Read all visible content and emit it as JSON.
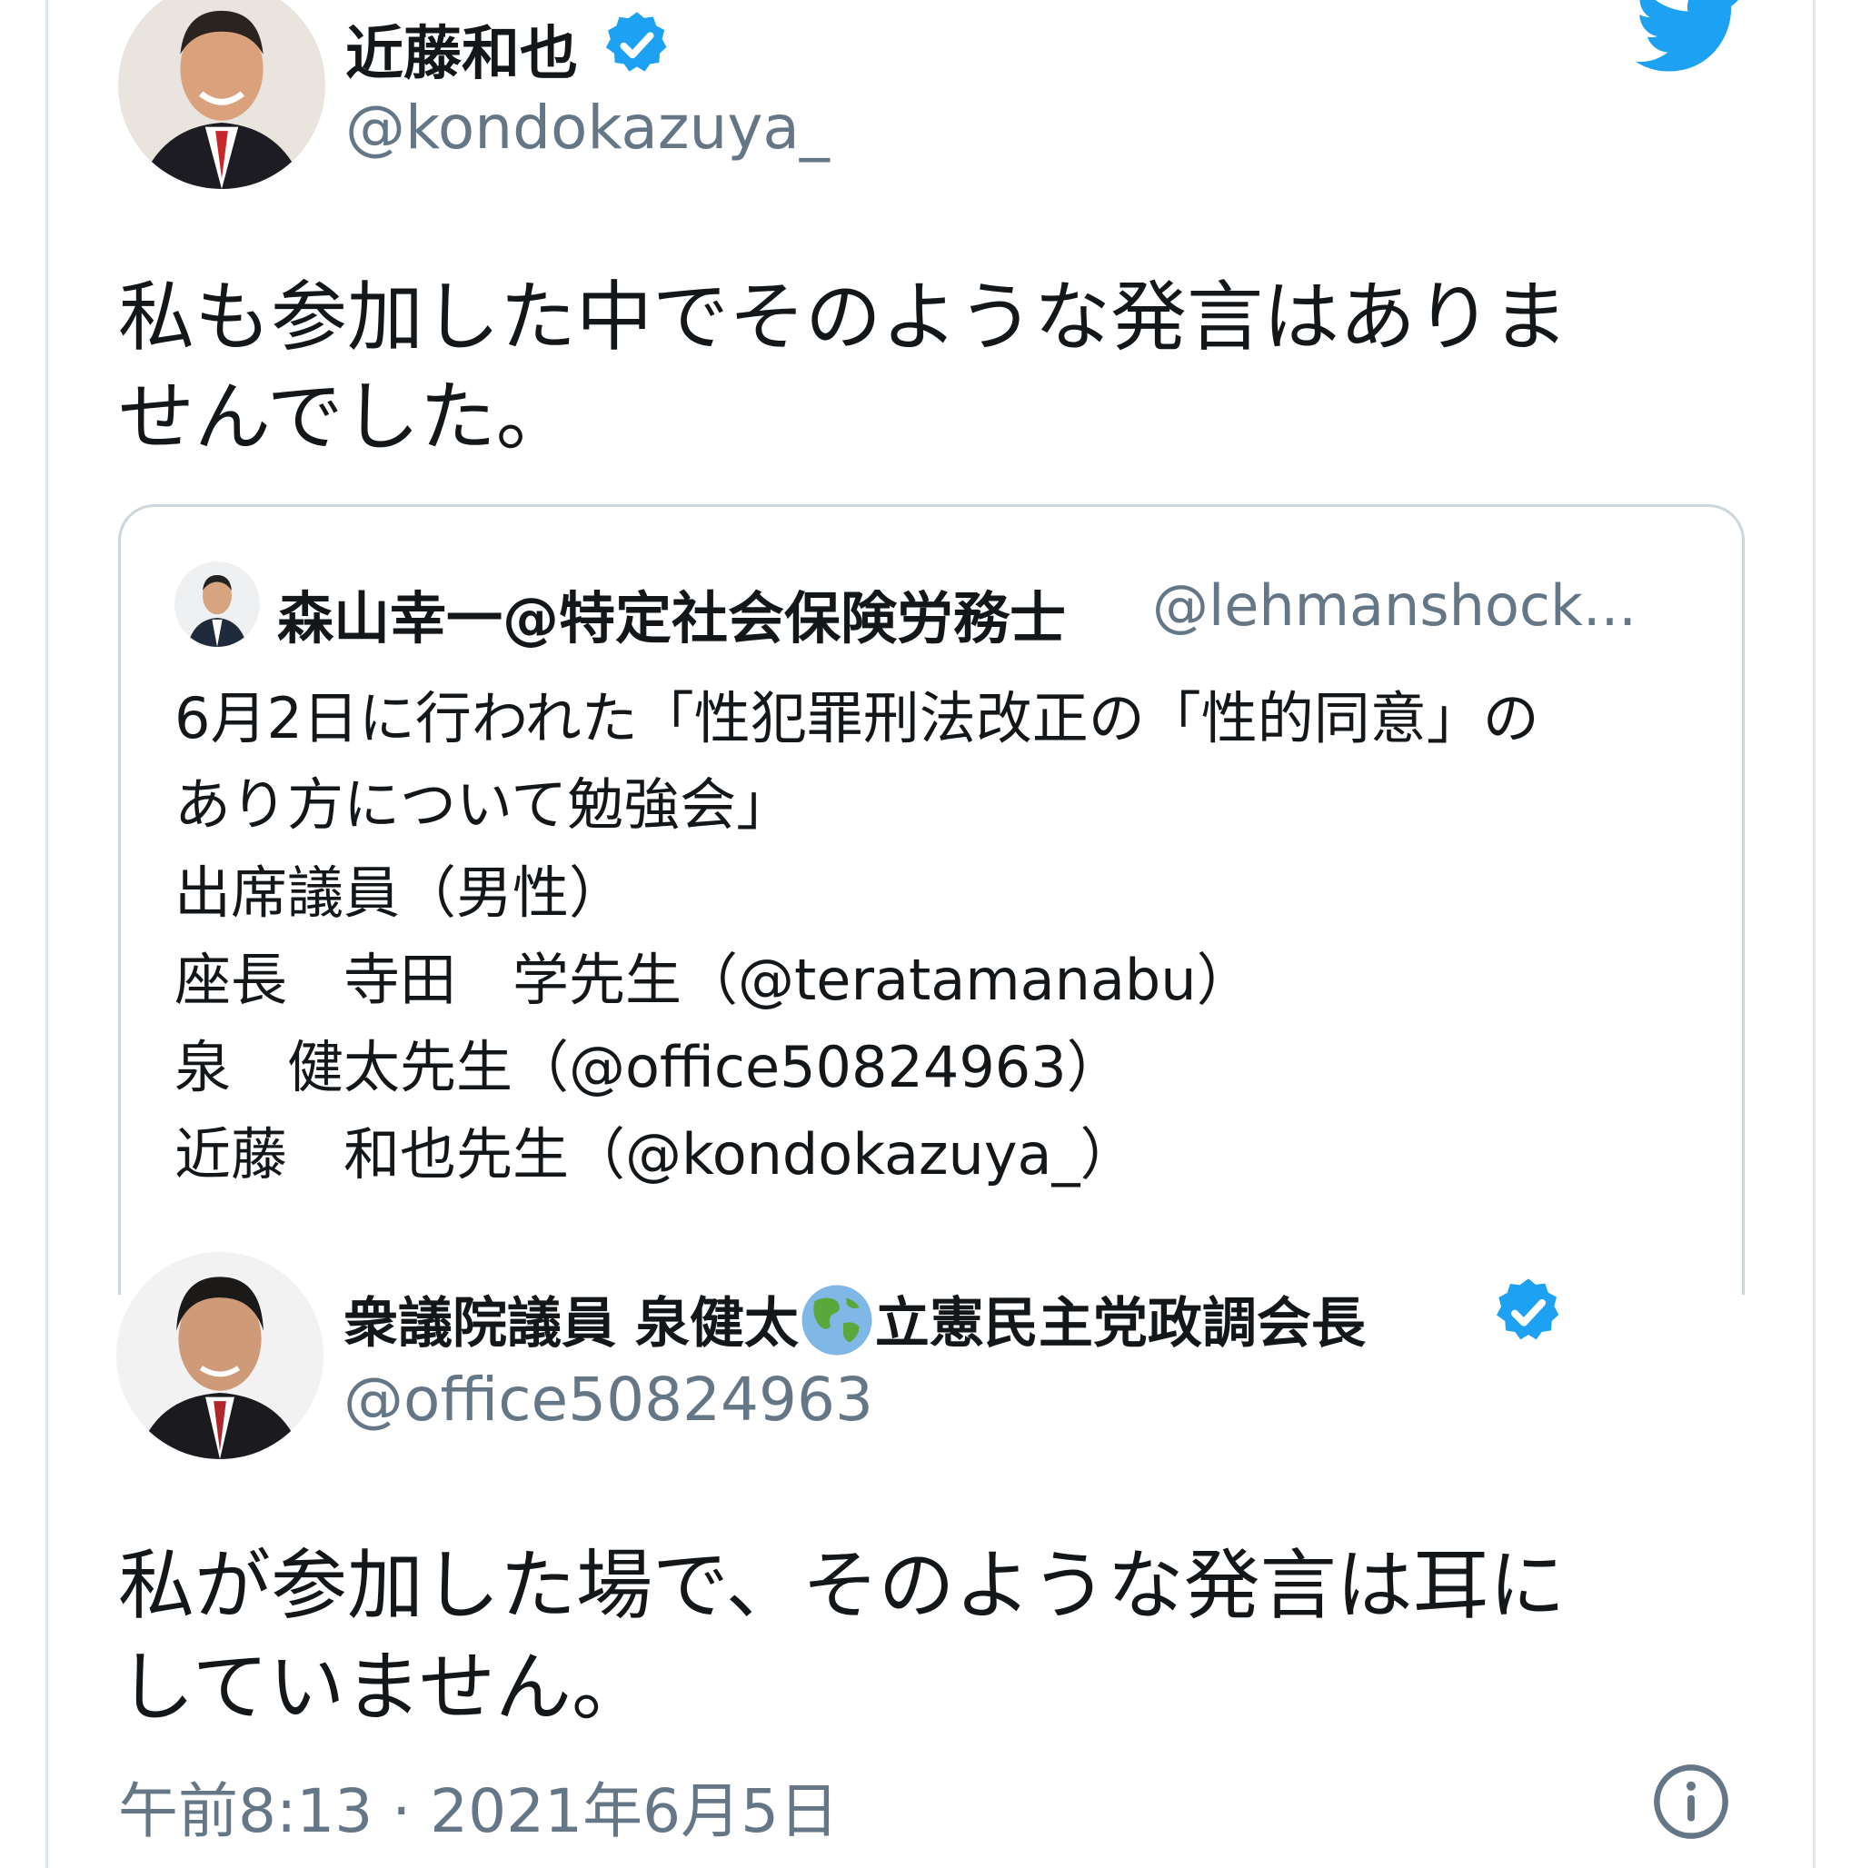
{
  "tweet_top": {
    "display_name": "近藤和也",
    "handle": "@kondokazuya_",
    "text_line1": "私も参加した中でそのような発言はありま",
    "text_line2": "せんでした。",
    "verified": true
  },
  "quoted_tweet": {
    "display_name": "森山幸一@特定社会保険労務士",
    "handle": "@lehmanshock...",
    "lines": [
      "6月2日に行われた「性犯罪刑法改正の「性的同意」の",
      "あり方について勉強会」",
      "出席議員（男性）",
      "座長　寺田　学先生（@teratamanabu）",
      "泉　健太先生（@office50824963）",
      "近藤　和也先生（@kondokazuya_）"
    ]
  },
  "tweet_bottom": {
    "display_name_part1": "衆議院議員 泉健太",
    "display_name_emoji": "globe-asia-icon",
    "display_name_part2": "立憲民主党政調会長",
    "handle": "@office50824963",
    "text_line1": "私が参加した場で、そのような発言は耳に",
    "text_line2": "していません。",
    "timestamp": "午前8:13 · 2021年6月5日",
    "verified": true
  },
  "colors": {
    "twitter_blue": "#1da1f2",
    "text_primary": "#14171a",
    "text_secondary": "#657786",
    "border": "#ccd6dd"
  }
}
